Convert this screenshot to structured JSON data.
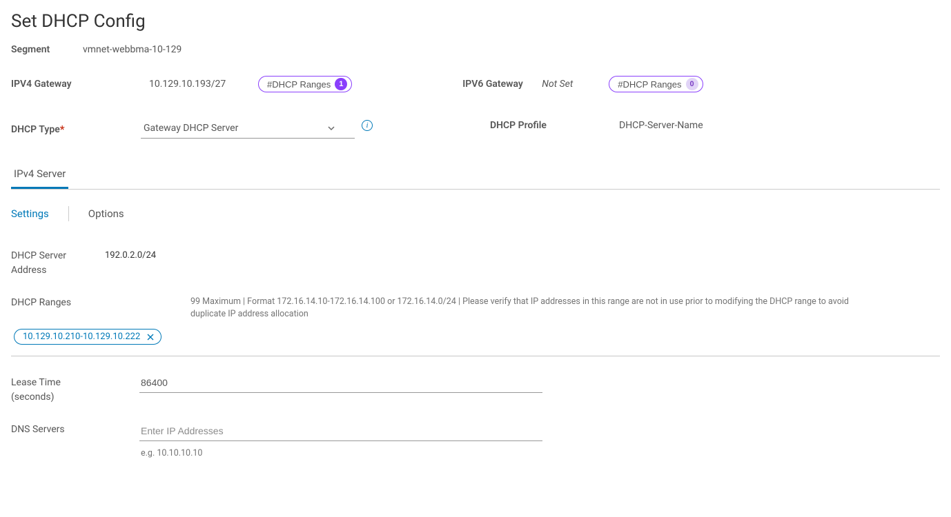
{
  "dialog": {
    "title": "Set DHCP Config"
  },
  "segment": {
    "label": "Segment",
    "value": "vmnet-webbma-10-129"
  },
  "ipv4": {
    "label": "IPV4 Gateway",
    "value": "10.129.10.193/27",
    "ranges_btn": "#DHCP Ranges",
    "ranges_count": "1"
  },
  "ipv6": {
    "label": "IPV6 Gateway",
    "value": "Not Set",
    "ranges_btn": "#DHCP Ranges",
    "ranges_count": "0"
  },
  "dhcp_type": {
    "label": "DHCP Type",
    "required_marker": "*",
    "value": "Gateway DHCP Server"
  },
  "dhcp_profile": {
    "label": "DHCP Profile",
    "value": "DHCP-Server-Name"
  },
  "tier1": {
    "tab_ipv4": "IPv4 Server"
  },
  "tier2": {
    "tab_settings": "Settings",
    "tab_options": "Options"
  },
  "server_addr": {
    "label_line1": "DHCP Server",
    "label_line2": "Address",
    "value": "192.0.2.0/24"
  },
  "ranges": {
    "label": "DHCP Ranges",
    "helper": "99 Maximum | Format 172.16.14.10-172.16.14.100 or 172.16.14.0/24 | Please verify that IP addresses in this range are not in use prior to modifying the DHCP range to avoid duplicate IP address allocation",
    "chip": "10.129.10.210-10.129.10.222"
  },
  "lease": {
    "label_line1": "Lease Time",
    "label_line2": "(seconds)",
    "value": "86400"
  },
  "dns": {
    "label": "DNS Servers",
    "placeholder": "Enter IP Addresses",
    "hint": "e.g. 10.10.10.10"
  }
}
